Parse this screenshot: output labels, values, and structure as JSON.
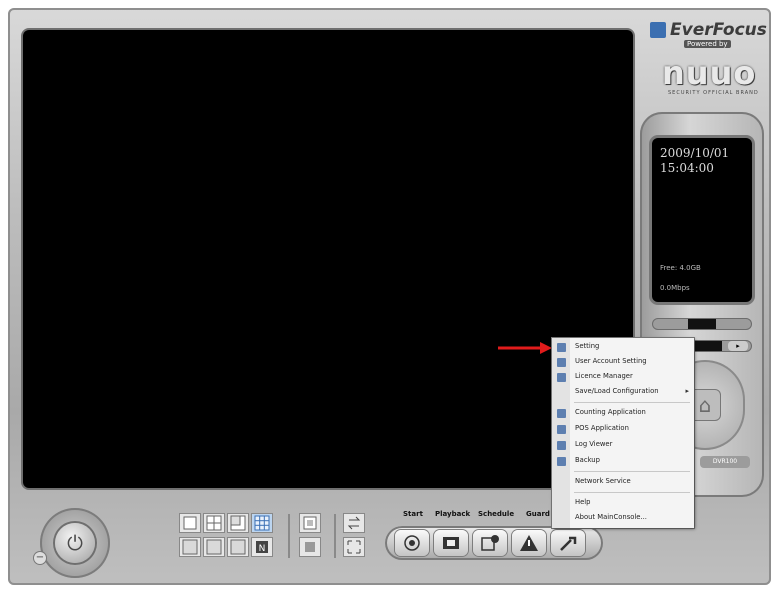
{
  "brand": {
    "name": "EverFocus",
    "powered": "Powered by",
    "logo": "nuuo",
    "tagline": "SECURITY OFFICIAL BRAND"
  },
  "status": {
    "date": "2009/10/01",
    "time": "15:04:00",
    "free": "Free: 4.0GB",
    "rate": "0.0Mbps"
  },
  "panel": {
    "mid_button": "▸",
    "bottom_label": "DVR100"
  },
  "toolbar": {
    "start_label": "Start",
    "playback_label": "Playback",
    "schedule_label": "Schedule",
    "guard_label": "Guard",
    "start_icon": "record-icon",
    "playback_icon": "film-icon",
    "schedule_icon": "calendar-icon",
    "guard_icon": "warning-icon",
    "config_icon": "wrench-icon"
  },
  "context_menu": {
    "items": [
      {
        "label": "Setting",
        "icon": "setting-icon"
      },
      {
        "label": "User Account Setting",
        "icon": "user-icon"
      },
      {
        "label": "Licence Manager",
        "icon": "licence-icon"
      },
      {
        "label": "Save/Load Configuration",
        "icon": "",
        "has_submenu": true,
        "submenu_glyph": "▸"
      },
      {
        "label": "Counting Application",
        "icon": "counter-icon"
      },
      {
        "label": "POS Application",
        "icon": "pos-icon"
      },
      {
        "label": "Log Viewer",
        "icon": "log-icon"
      },
      {
        "label": "Backup",
        "icon": "backup-icon"
      },
      {
        "label": "Network Service",
        "icon": ""
      },
      {
        "label": "Help",
        "icon": ""
      },
      {
        "label": "About MainConsole...",
        "icon": ""
      }
    ]
  },
  "colors": {
    "arrow": "#e11b1b",
    "menu_icon": "#5d7fb0",
    "video_bg": "#000000"
  }
}
